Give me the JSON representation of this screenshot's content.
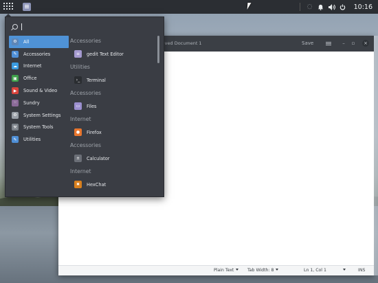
{
  "panel": {
    "clock": "10:16",
    "tray_icons": [
      "cast-icon",
      "bell-icon",
      "volume-icon",
      "power-icon"
    ]
  },
  "gedit": {
    "title": "Unsaved Document 1",
    "save_label": "Save",
    "status": {
      "lang": "Plain Text",
      "tab_width": "Tab Width: 8",
      "position": "Ln 1, Col 1",
      "mode": "INS"
    }
  },
  "menu": {
    "search": {
      "value": ""
    },
    "categories": [
      {
        "label": "All",
        "icon": "gear-icon",
        "color": "#5d86b8"
      },
      {
        "label": "Accessories",
        "icon": "accessories-icon",
        "color": "#4f8fd6"
      },
      {
        "label": "Internet",
        "icon": "cloud-icon",
        "color": "#3a9be0"
      },
      {
        "label": "Office",
        "icon": "office-icon",
        "color": "#3ea04a"
      },
      {
        "label": "Sound & Video",
        "icon": "play-icon",
        "color": "#d9433b"
      },
      {
        "label": "Sundry",
        "icon": "grid-icon",
        "color": "#8a6a98"
      },
      {
        "label": "System Settings",
        "icon": "settings-icon",
        "color": "#9aa0a8"
      },
      {
        "label": "System Tools",
        "icon": "tools-icon",
        "color": "#7d838b"
      },
      {
        "label": "Utilities",
        "icon": "utilities-icon",
        "color": "#4f8fd6"
      }
    ],
    "results": [
      {
        "group": "Accessories",
        "app": "gedit Text Editor",
        "icon": "text-editor-icon",
        "color": "#a59ad0"
      },
      {
        "group": "Utilities",
        "app": "Terminal",
        "icon": "terminal-icon",
        "color": "#2a2d31"
      },
      {
        "group": "Accessories",
        "app": "Files",
        "icon": "files-icon",
        "color": "#9b8fcf"
      },
      {
        "group": "Internet",
        "app": "Firefox",
        "icon": "firefox-icon",
        "color": "#e8762e"
      },
      {
        "group": "Accessories",
        "app": "Calculator",
        "icon": "calculator-icon",
        "color": "#6b6f77"
      },
      {
        "group": "Internet",
        "app": "HexChat",
        "icon": "hexchat-icon",
        "color": "#d9801e"
      }
    ]
  }
}
